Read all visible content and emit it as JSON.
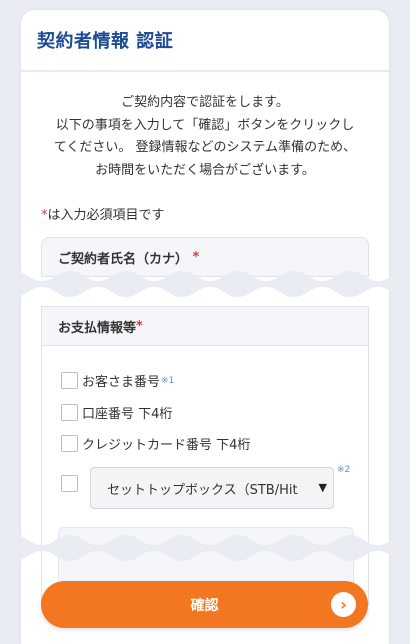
{
  "header": {
    "title": "契約者情報 認証"
  },
  "intro": {
    "line1": "ご契約内容で認証をします。",
    "line2": "以下の事項を入力して「確認」ボタンをクリックし",
    "line3": "てください。 登録情報などのシステム準備のため、",
    "line4": "お時間をいただく場合がございます。"
  },
  "required_note": {
    "mark": "*",
    "text": "は入力必須項目です"
  },
  "section_name": {
    "label": "ご契約者氏名（カナ）",
    "mark": "*"
  },
  "section_payment": {
    "label": "お支払情報等",
    "mark": "*",
    "options": [
      {
        "label": "お客さま番号",
        "note": "※1"
      },
      {
        "label": "口座番号 下4桁"
      },
      {
        "label": "クレジットカード番号 下4桁"
      }
    ],
    "select": {
      "value": "セットトップボックス（STB/Hit",
      "note": "※2"
    }
  },
  "confirm_button": {
    "label": "確認",
    "icon": "chevron-right-icon"
  },
  "colors": {
    "title": "#1d4b96",
    "accent": "#f37720",
    "required": "#e0344b"
  }
}
